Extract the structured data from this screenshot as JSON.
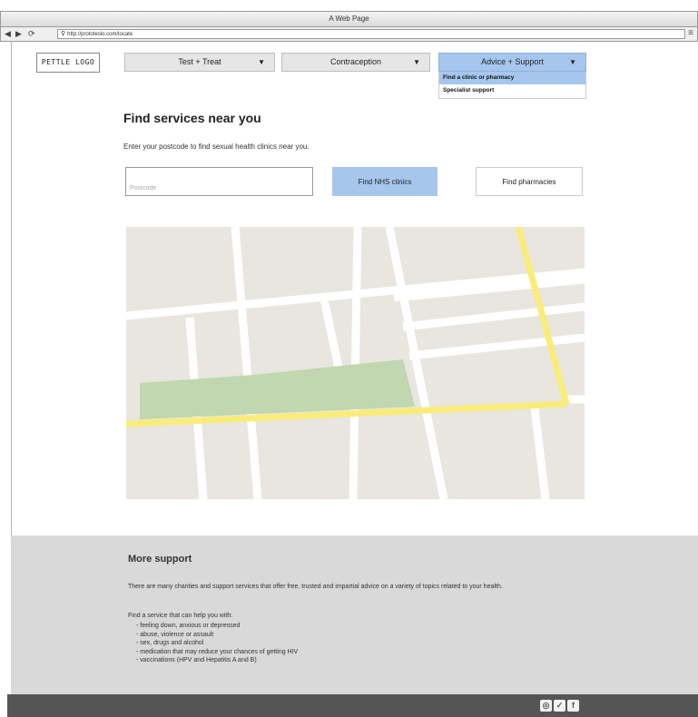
{
  "window": {
    "title": "A Web Page"
  },
  "browser": {
    "back": "◀",
    "forward": "▶",
    "reload": "⟳",
    "url": "http://prototeslo.com/locate",
    "menu_icon": "hamburger-icon"
  },
  "site": {
    "logo": "PETTLE LOGO"
  },
  "nav": {
    "tabs": [
      {
        "label": "Test + Treat"
      },
      {
        "label": "Contraception"
      },
      {
        "label": "Advice + Support"
      }
    ],
    "dropdown": [
      {
        "label": "Find a clinic or pharmacy"
      },
      {
        "label": "Specialist support"
      }
    ]
  },
  "main": {
    "heading": "Find services near you",
    "subtext": "Enter your postcode to find sexual health clinics near you.",
    "postcode_placeholder": "Postcode",
    "nhs_button": "Find NHS clinics",
    "pharmacy_button": "Find pharmacies"
  },
  "map_colors": {
    "background": "#e8e6df",
    "road": "#ffffff",
    "major_road": "#f9ec7a",
    "park": "#c0d7b0"
  },
  "more_support": {
    "title": "More support",
    "paragraph": "There are many charities and support services that offer free, trusted and impartial advice on a variety of topics related to your health.",
    "list_label": "Find a service that can help you with:",
    "items": [
      "feeling down, anxious or depressed",
      "abuse, violence or assault",
      "sex, drugs and alcohol",
      "medication that may reduce your chances of getting HIV",
      "vaccinations (HPV and Hepatitis A and B)"
    ]
  },
  "footer": {
    "social": [
      {
        "icon": "instagram-icon",
        "glyph": "◎"
      },
      {
        "icon": "twitter-icon",
        "glyph": "✓"
      },
      {
        "icon": "facebook-icon",
        "glyph": "f"
      }
    ]
  }
}
